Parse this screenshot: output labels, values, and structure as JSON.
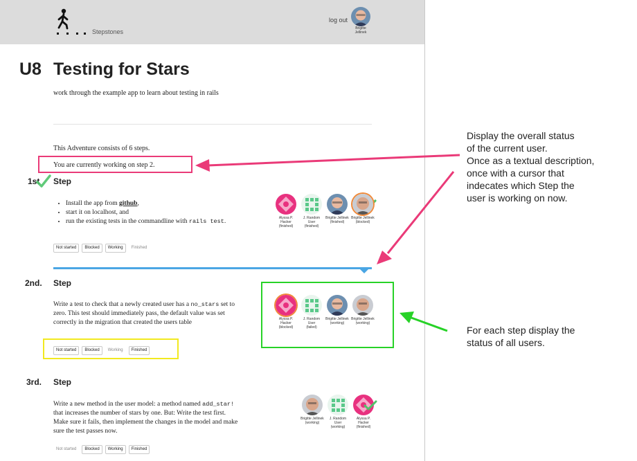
{
  "header": {
    "brand": "Stepstones",
    "logout": "log out",
    "user_name": "Brigitte Jellinek"
  },
  "adventure": {
    "unit": "U8",
    "title": "Testing for Stars",
    "subtitle": "work through the example app to learn about testing in rails",
    "consists": "This Adventure consists of 6 steps.",
    "current": "You are currently working on step 2."
  },
  "steps": [
    {
      "number": "1st",
      "heading": "Step",
      "items": [
        "Install the app from ",
        "github",
        ",",
        "start it on localhost, and",
        "run the existing tests in the commandline with ",
        "rails test",
        "."
      ],
      "buttons": [
        "Not started",
        "Blocked",
        "Working",
        "Finished"
      ],
      "users": [
        {
          "name": "Alyssa P. Hacker",
          "status": "(finished)"
        },
        {
          "name": "J. Random User",
          "status": "(finished)"
        },
        {
          "name": "Brigitte Jellinek",
          "status": "(finished)"
        },
        {
          "name": "Brigitte Jellinek",
          "status": "(blocked)"
        }
      ]
    },
    {
      "number": "2nd.",
      "heading": "Step",
      "text": [
        "Write a test to check that a newly created user has a ",
        "no_stars",
        " set to zero. This test should immediately pass, the default value was set correctly in the migration that created the users table"
      ],
      "buttons": [
        "Not started",
        "Blocked",
        "Working",
        "Finished"
      ],
      "users": [
        {
          "name": "Alyssa P. Hacker",
          "status": "(blocked)"
        },
        {
          "name": "J. Random User",
          "status": "(failed)"
        },
        {
          "name": "Brigitte Jellinek",
          "status": "(working)"
        },
        {
          "name": "Brigitte Jellinek",
          "status": "(working)"
        }
      ]
    },
    {
      "number": "3rd.",
      "heading": "Step",
      "text": [
        "Write a new method in the user model: a method named ",
        "add_star!",
        " that increases the number of stars by one. But: Write the test first. Make sure it fails, then implement the changes in the model and make sure the test passes now."
      ],
      "buttons": [
        "Not started",
        "Blocked",
        "Working",
        "Finished"
      ],
      "users": [
        {
          "name": "Brigitte Jellinek",
          "status": "(working)"
        },
        {
          "name": "J. Random User",
          "status": "(working)"
        },
        {
          "name": "Alyssa P. Hacker",
          "status": "(finished)"
        }
      ]
    }
  ],
  "annotations": {
    "overall": [
      "Display the overall status",
      "of the current user.",
      "Once as a textual description,",
      "once with a cursor that",
      "indecates which Step the",
      "user is working on now."
    ],
    "each": [
      "For each step display the",
      "status of all users."
    ]
  },
  "colors": {
    "topbar": "#dcdcdc",
    "progress": "#4aa6e4",
    "check": "#4fc46a",
    "anno_pink": "#ea3a78",
    "anno_green": "#27d227",
    "anno_yellow": "#f2e91f"
  }
}
